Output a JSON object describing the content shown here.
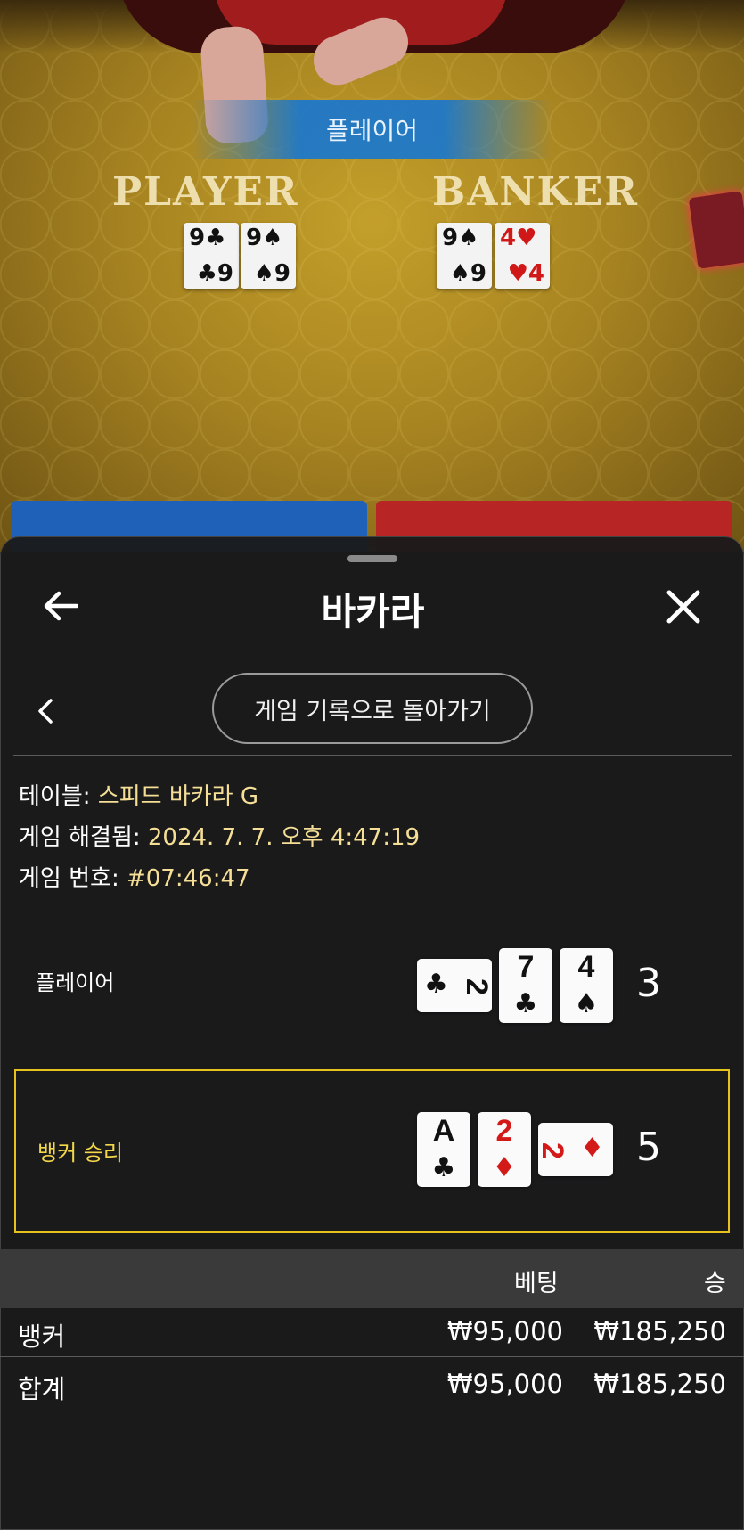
{
  "table": {
    "banner": "플레이어",
    "felt_player": "PLAYER",
    "felt_banker": "BANKER",
    "player_cards": [
      {
        "rank": "9",
        "suit": "♣",
        "color": "black"
      },
      {
        "rank": "9",
        "suit": "♠",
        "color": "black"
      }
    ],
    "banker_cards": [
      {
        "rank": "9",
        "suit": "♠",
        "color": "black"
      },
      {
        "rank": "4",
        "suit": "♥",
        "color": "red"
      }
    ]
  },
  "header": {
    "title": "바카라",
    "back_icon": "←",
    "close_icon": "✕"
  },
  "nav": {
    "prev_icon": "‹",
    "history_button": "게임 기록으로 돌아가기"
  },
  "info": {
    "table_label": "테이블: ",
    "table_value": "스피드 바카라 G",
    "resolved_label": "게임 해결됨: ",
    "resolved_value": "2024. 7. 7. 오후 4:47:19",
    "game_no_label": "게임 번호: ",
    "game_no_value": "#07:46:47"
  },
  "hands": {
    "player": {
      "label": "플레이어",
      "score": "3",
      "cards": [
        {
          "rank": "2",
          "suit": "♣",
          "color": "black",
          "orientation": "horizontal"
        },
        {
          "rank": "7",
          "suit": "♣",
          "color": "black",
          "orientation": "vertical"
        },
        {
          "rank": "4",
          "suit": "♠",
          "color": "black",
          "orientation": "vertical"
        }
      ]
    },
    "banker": {
      "label": "뱅커 승리",
      "score": "5",
      "cards": [
        {
          "rank": "A",
          "suit": "♣",
          "color": "black",
          "orientation": "vertical"
        },
        {
          "rank": "2",
          "suit": "♦",
          "color": "red",
          "orientation": "vertical"
        },
        {
          "rank": "2",
          "suit": "♦",
          "color": "red",
          "orientation": "horizontal"
        }
      ]
    }
  },
  "bets": {
    "col_bet": "베팅",
    "col_win": "승",
    "rows": [
      {
        "label": "뱅커",
        "bet": "₩95,000",
        "win": "₩185,250"
      }
    ],
    "total": {
      "label": "합계",
      "bet": "₩95,000",
      "win": "₩185,250"
    }
  },
  "colors": {
    "winner_highlight": "#e8c21c",
    "info_value": "#f5df97",
    "sheet_bg": "#1a1a1b"
  }
}
